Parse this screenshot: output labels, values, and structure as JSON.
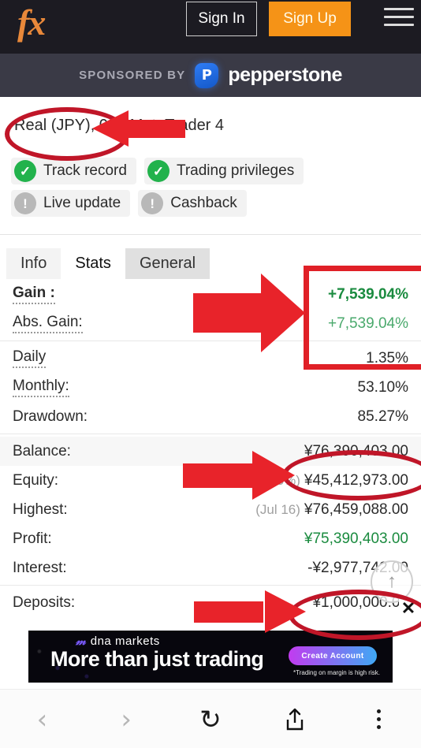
{
  "topbar": {
    "logo_text": "fx",
    "sign_in_label": "Sign In",
    "sign_up_label": "Sign Up",
    "menu_icon": "hamburger-menu-icon"
  },
  "sponsor": {
    "label": "SPONSORED BY",
    "brand_mark": "P",
    "brand_name": "pepperstone"
  },
  "account": {
    "title": "Real (JPY),                     00 , MetaTrader 4",
    "badges": [
      {
        "label": "Track record",
        "icon": "check-circle-icon",
        "state": "ok"
      },
      {
        "label": "Trading privileges",
        "icon": "check-circle-icon",
        "state": "ok"
      },
      {
        "label": "Live update",
        "icon": "exclamation-circle-icon",
        "state": "warn"
      },
      {
        "label": "Cashback",
        "icon": "exclamation-circle-icon",
        "state": "warn"
      }
    ]
  },
  "tabs": [
    {
      "label": "Info",
      "active": false
    },
    {
      "label": "Stats",
      "active": true
    },
    {
      "label": "General",
      "active": false
    }
  ],
  "stats": {
    "rows": [
      {
        "label": "Gain :",
        "value": "+7,539.04%"
      },
      {
        "label": "Abs. Gain:",
        "value": "+7,539.04%"
      },
      {
        "label": "Daily",
        "value": "1.35%"
      },
      {
        "label": "Monthly:",
        "value": "53.10%"
      },
      {
        "label": "Drawdown:",
        "value": "85.27%"
      },
      {
        "label": "Balance:",
        "value": "¥76,390,403.00"
      },
      {
        "label": "Equity:",
        "value": "¥45,412,973.00",
        "sub": "(59.45%)"
      },
      {
        "label": "Highest:",
        "value": "¥76,459,088.00",
        "sub": "(Jul 16)"
      },
      {
        "label": "Profit:",
        "value": "¥75,390,403.00"
      },
      {
        "label": "Interest:",
        "value": "-¥2,977,742.00"
      },
      {
        "label": "Deposits:",
        "value": "¥1,000,000.00"
      }
    ]
  },
  "overlay": {
    "scroll_top_icon": "arrow-up-icon",
    "close_label": "✕",
    "accent_red": "#e8232a",
    "annotation_red": "#c01628"
  },
  "ad": {
    "brand_mark": "𝓂",
    "brand_name": "dna markets",
    "headline": "More than just trading",
    "cta_label": "Create Account",
    "disclaimer": "*Trading on margin is high risk."
  },
  "browser_nav": {
    "back_icon": "‹",
    "forward_icon": "›",
    "reload_icon": "↻",
    "share_icon": "share-icon",
    "menu_icon": "overflow-menu-icon"
  }
}
